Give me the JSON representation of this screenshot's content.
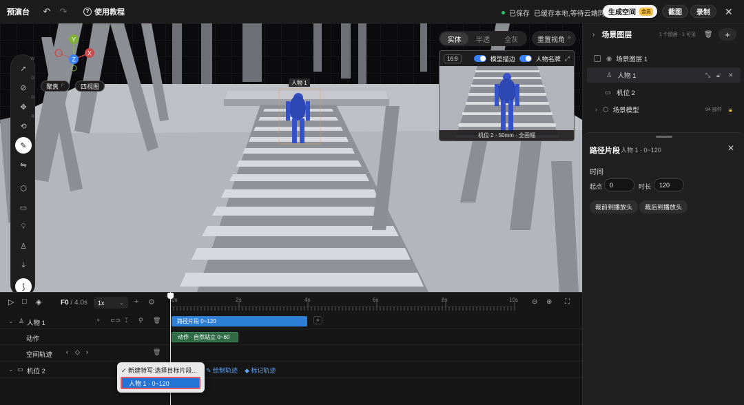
{
  "topbar": {
    "app_title": "预演台",
    "tutorial_label": "使用教程",
    "save_status": "已保存",
    "sync_status": "已缓存本地,等待云端同步",
    "generate_label": "生成空间",
    "vip_badge": "会员",
    "screenshot_label": "截图",
    "record_label": "录制"
  },
  "viewport": {
    "focus_label": "聚焦",
    "focus_key": "F",
    "four_view_label": "四视图",
    "character_tag": "人物 1",
    "gizmo": {
      "y": "Y",
      "x": "X",
      "z": "Z"
    },
    "view_modes": [
      "实体",
      "半透",
      "全灰"
    ],
    "active_view_mode": "实体",
    "reset_view_label": "重置视角",
    "reset_view_key": "R",
    "tools": [
      {
        "name": "select-tool",
        "key": "W"
      },
      {
        "name": "orbit-tool",
        "key": "G"
      },
      {
        "name": "move-tool",
        "key": "G"
      },
      {
        "name": "rotate-tool",
        "key": "R"
      },
      {
        "name": "path-tool",
        "key": ""
      },
      {
        "name": "mirror-tool",
        "key": ""
      },
      {
        "name": "cube-tool",
        "key": ""
      },
      {
        "name": "camera-tool",
        "key": ""
      },
      {
        "name": "light-tool",
        "key": ""
      },
      {
        "name": "person-tool",
        "key": ""
      },
      {
        "name": "import-tool",
        "key": ""
      },
      {
        "name": "route-tool",
        "key": ""
      }
    ]
  },
  "preview": {
    "aspect": "16:9",
    "outline_label": "模型描边",
    "nameplate_label": "人物名牌",
    "caption": "机位 2 · 50mm · 全画幅"
  },
  "layers": {
    "title": "场景图层",
    "meta": "1 个图层 · 1 可见",
    "items": [
      {
        "label": "场景图层 1"
      },
      {
        "label": "人物 1"
      },
      {
        "label": "机位 2"
      },
      {
        "label": "场景模型",
        "count": "94 部件"
      }
    ]
  },
  "props": {
    "title": "路径片段",
    "subtitle": "人物 1 · 0~120",
    "section": "时间",
    "start_label": "起点",
    "start_value": "0",
    "duration_label": "时长",
    "duration_value": "120",
    "trim_before": "裁前到播放头",
    "trim_after": "裁后到播放头"
  },
  "timeline": {
    "frame": "F0",
    "total": "/ 4.0s",
    "speed": "1x",
    "ticks": [
      "0s",
      "2s",
      "4s",
      "6s",
      "8s",
      "10s"
    ],
    "tracks": [
      {
        "name": "人物 1"
      },
      {
        "name": "动作"
      },
      {
        "name": "空间轨迹"
      },
      {
        "name": "机位 2"
      }
    ],
    "clips": {
      "path": "路径片段 0~120",
      "action": "动作 · 自然站立 0~60"
    },
    "draw_track": "绘制轨迹",
    "mark_track": "标记轨迹",
    "menu": {
      "item1": "新建特写:选择目标片段...",
      "item2": "人物 1 · 0~120"
    }
  },
  "colors": {
    "accent": "#2e7fd6",
    "status_green": "#2fbf71",
    "vip_gold": "#f3c24a"
  }
}
